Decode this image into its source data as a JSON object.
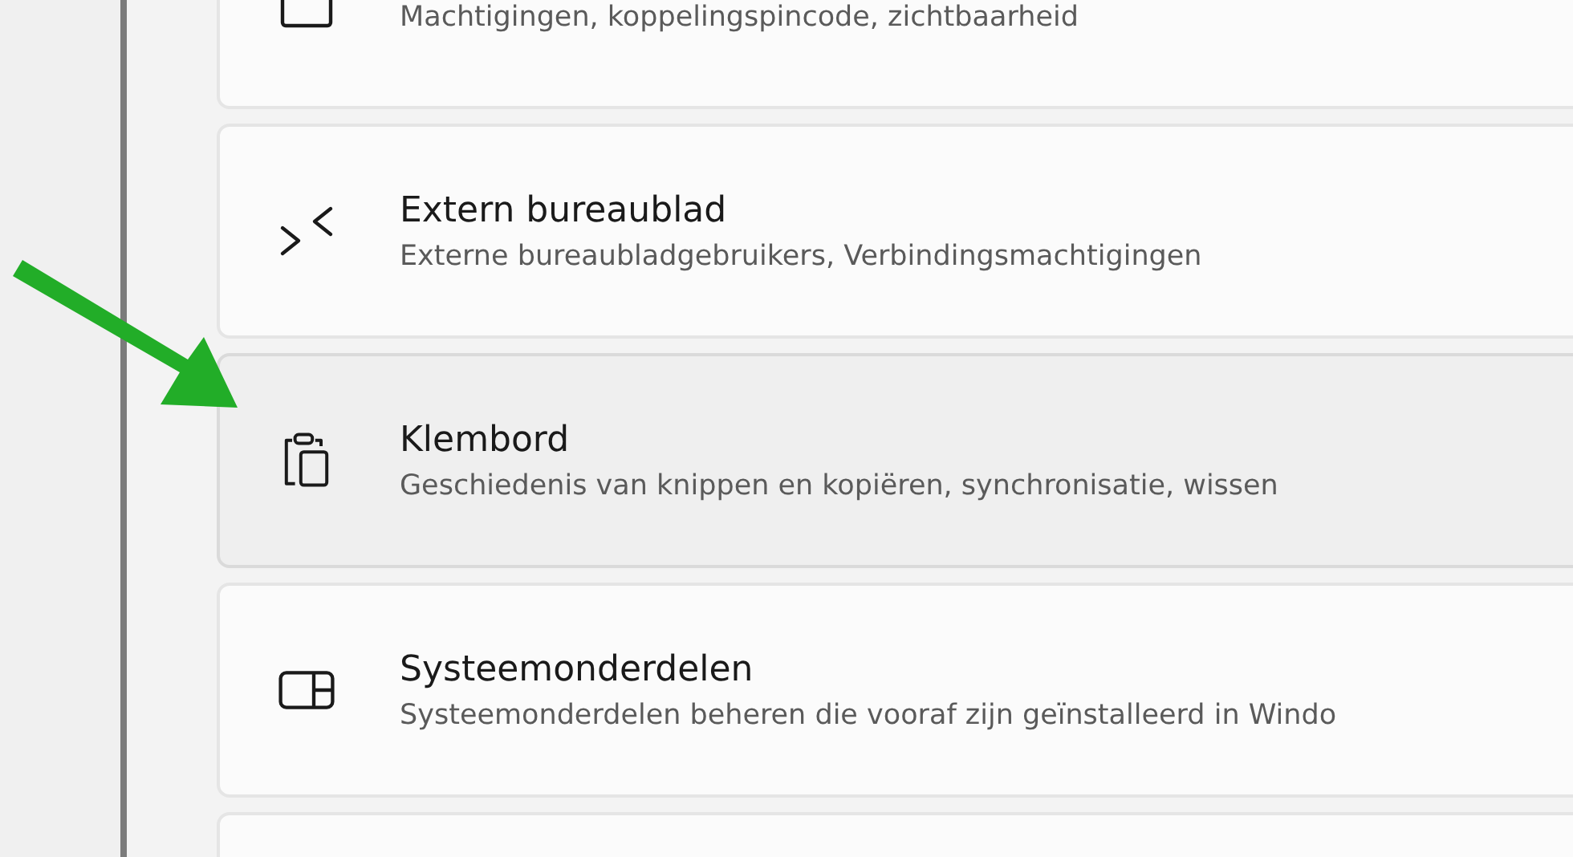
{
  "settings_list": [
    {
      "subtitle": "Machtigingen, koppelingspincode, zichtbaarheid",
      "selected": false
    },
    {
      "title": "Extern bureaublad",
      "subtitle": "Externe bureaubladgebruikers, Verbindingsmachtigingen",
      "selected": false
    },
    {
      "title": "Klembord",
      "subtitle": "Geschiedenis van knippen en kopiëren, synchronisatie, wissen",
      "selected": true
    },
    {
      "title": "Systeemonderdelen",
      "subtitle": "Systeemonderdelen beheren die vooraf zijn geïnstalleerd in Windo",
      "selected": false
    }
  ]
}
